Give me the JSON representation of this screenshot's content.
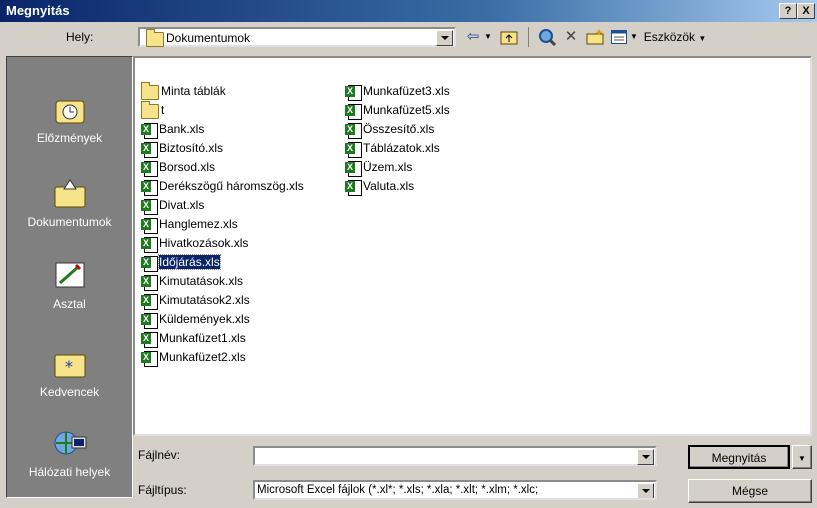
{
  "window": {
    "title": "Megnyitás",
    "help_label": "?",
    "close_label": "X"
  },
  "location": {
    "label": "Hely:",
    "current": "Dokumentumok"
  },
  "toolbar": {
    "back_icon": "back-arrow-icon",
    "up_icon": "up-folder-icon",
    "search_web_icon": "search-web-icon",
    "delete_icon": "delete-icon",
    "new_folder_icon": "new-folder-icon",
    "views_icon": "views-icon",
    "tools_label": "Eszközök"
  },
  "places": [
    {
      "label": "Előzmények",
      "icon": "history-icon"
    },
    {
      "label": "Dokumentumok",
      "icon": "my-documents-icon"
    },
    {
      "label": "Asztal",
      "icon": "desktop-icon"
    },
    {
      "label": "Kedvencek",
      "icon": "favorites-icon"
    },
    {
      "label": "Hálózati helyek",
      "icon": "network-places-icon"
    }
  ],
  "files_col1": [
    {
      "name": "Minta táblák",
      "type": "folder"
    },
    {
      "name": "t",
      "type": "folder"
    },
    {
      "name": "Bank.xls",
      "type": "xls"
    },
    {
      "name": "Biztosító.xls",
      "type": "xls"
    },
    {
      "name": "Borsod.xls",
      "type": "xls"
    },
    {
      "name": "Derékszögű háromszög.xls",
      "type": "xls"
    },
    {
      "name": "Divat.xls",
      "type": "xls"
    },
    {
      "name": "Hanglemez.xls",
      "type": "xls"
    },
    {
      "name": "Hivatkozások.xls",
      "type": "xls"
    },
    {
      "name": "Időjárás.xls",
      "type": "xls",
      "selected": true
    },
    {
      "name": "Kimutatások.xls",
      "type": "xls"
    },
    {
      "name": "Kimutatások2.xls",
      "type": "xls"
    },
    {
      "name": "Küldemények.xls",
      "type": "xls"
    },
    {
      "name": "Munkafüzet1.xls",
      "type": "xls"
    },
    {
      "name": "Munkafüzet2.xls",
      "type": "xls"
    }
  ],
  "files_col2": [
    {
      "name": "Munkafüzet3.xls",
      "type": "xls"
    },
    {
      "name": "Munkafüzet5.xls",
      "type": "xls"
    },
    {
      "name": "Összesítő.xls",
      "type": "xls"
    },
    {
      "name": "Táblázatok.xls",
      "type": "xls"
    },
    {
      "name": "Üzem.xls",
      "type": "xls"
    },
    {
      "name": "Valuta.xls",
      "type": "xls"
    }
  ],
  "filename": {
    "label": "Fájlnév:",
    "value": ""
  },
  "filetype": {
    "label": "Fájltípus:",
    "value": "Microsoft Excel fájlok (*.xl*; *.xls; *.xla; *.xlt; *.xlm; *.xlc;"
  },
  "buttons": {
    "open": "Megnyitás",
    "cancel": "Mégse"
  }
}
